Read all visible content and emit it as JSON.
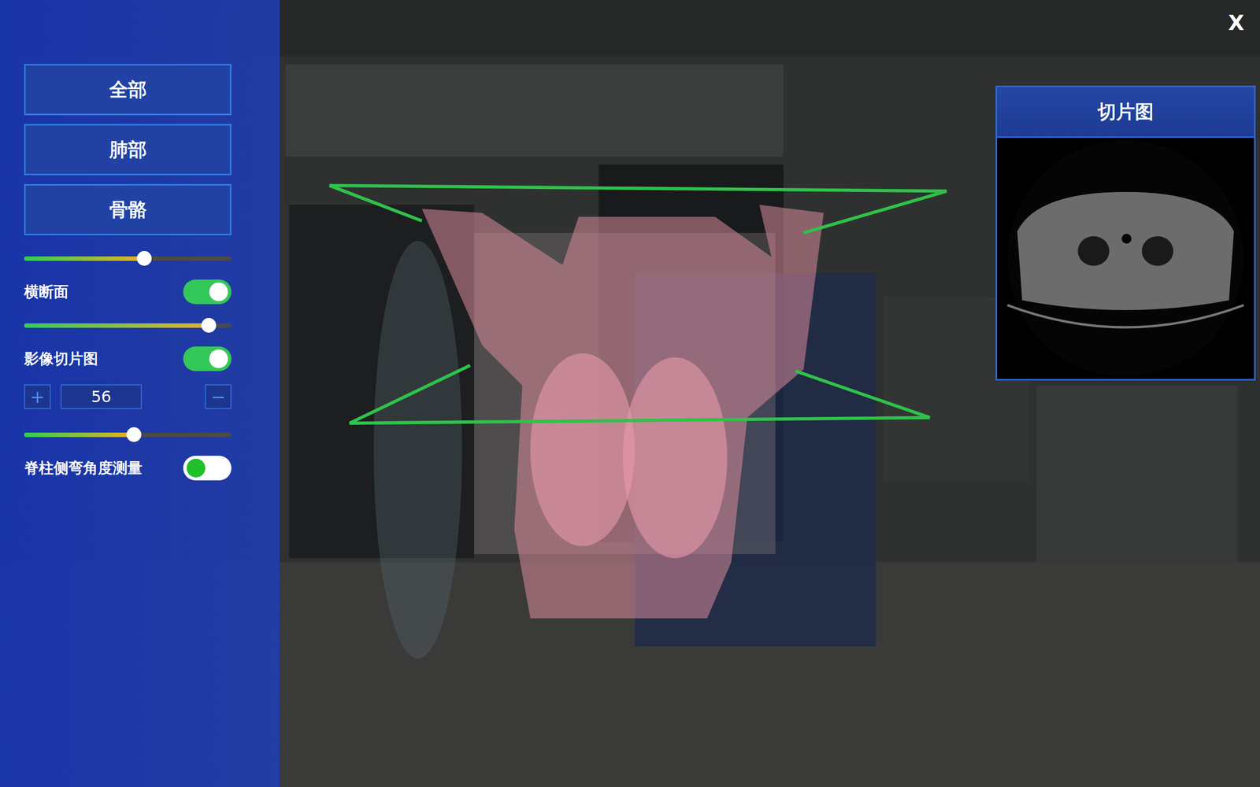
{
  "close_button": "X",
  "view_buttons": [
    {
      "label": "全部",
      "selected": false
    },
    {
      "label": "肺部",
      "selected": false
    },
    {
      "label": "骨骼",
      "selected": false
    }
  ],
  "controls": [
    {
      "kind": "slider",
      "level": 0.58
    },
    {
      "kind": "toggle",
      "label": "横断面",
      "on": true
    },
    {
      "kind": "slider",
      "level": 0.89
    },
    {
      "kind": "toggle",
      "label": "影像切片图",
      "on": true
    },
    {
      "kind": "stepper",
      "plus": "+",
      "value": "56",
      "minus": "−"
    },
    {
      "kind": "slider",
      "level": 0.53
    },
    {
      "kind": "toggle",
      "label": "脊柱侧弯角度测量",
      "on": false
    }
  ],
  "slice_panel": {
    "title": "切片图"
  }
}
